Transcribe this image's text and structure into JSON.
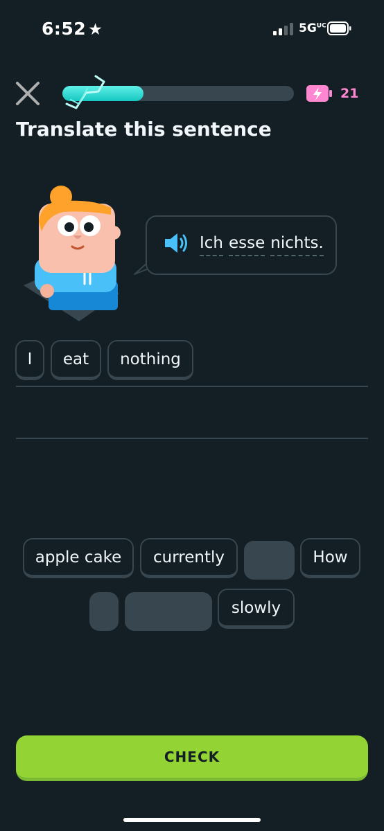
{
  "status_bar": {
    "time": "6:52",
    "star": "★",
    "network": "5G",
    "network_sup": "UC",
    "signal_icon": "cell-signal-icon",
    "battery_icon": "battery-icon"
  },
  "header": {
    "close_icon": "close-icon",
    "progress": 0.35,
    "energy_icon": "energy-battery-icon",
    "energy_count": "21",
    "colors": {
      "progress": "#1cc9c2",
      "energy": "#ff86d0"
    }
  },
  "challenge": {
    "title": "Translate this sentence",
    "prompt_words": [
      "Ich",
      "esse",
      "nichts."
    ],
    "speaker_icon": "speaker-icon"
  },
  "answer_tiles": [
    "I",
    "eat",
    "nothing"
  ],
  "word_bank": [
    "apple cake",
    "currently",
    "How",
    "slowly"
  ],
  "check_label": "CHECK",
  "colors": {
    "background": "#131f24",
    "border": "#37464f",
    "check": "#93d333"
  }
}
